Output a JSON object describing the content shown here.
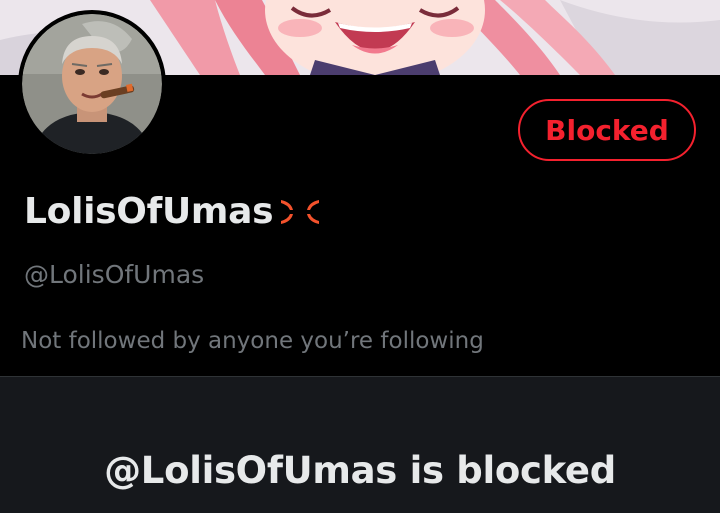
{
  "banner": {
    "image": "anime-illustration-banner"
  },
  "avatar": {
    "image": "profile-photo"
  },
  "actions": {
    "blocked_label": "Blocked"
  },
  "profile": {
    "display_name": "LolisOfUmas",
    "name_emoji": "anger-symbol-icon",
    "handle": "@LolisOfUmas",
    "followed_by": "Not followed by anyone you’re following"
  },
  "blocked_notice": {
    "title": "@LolisOfUmas is blocked"
  },
  "colors": {
    "background": "#000000",
    "blocked_red": "#f4212e",
    "text_primary": "#e7e9ea",
    "text_secondary": "#71767b",
    "panel": "#16181c"
  }
}
